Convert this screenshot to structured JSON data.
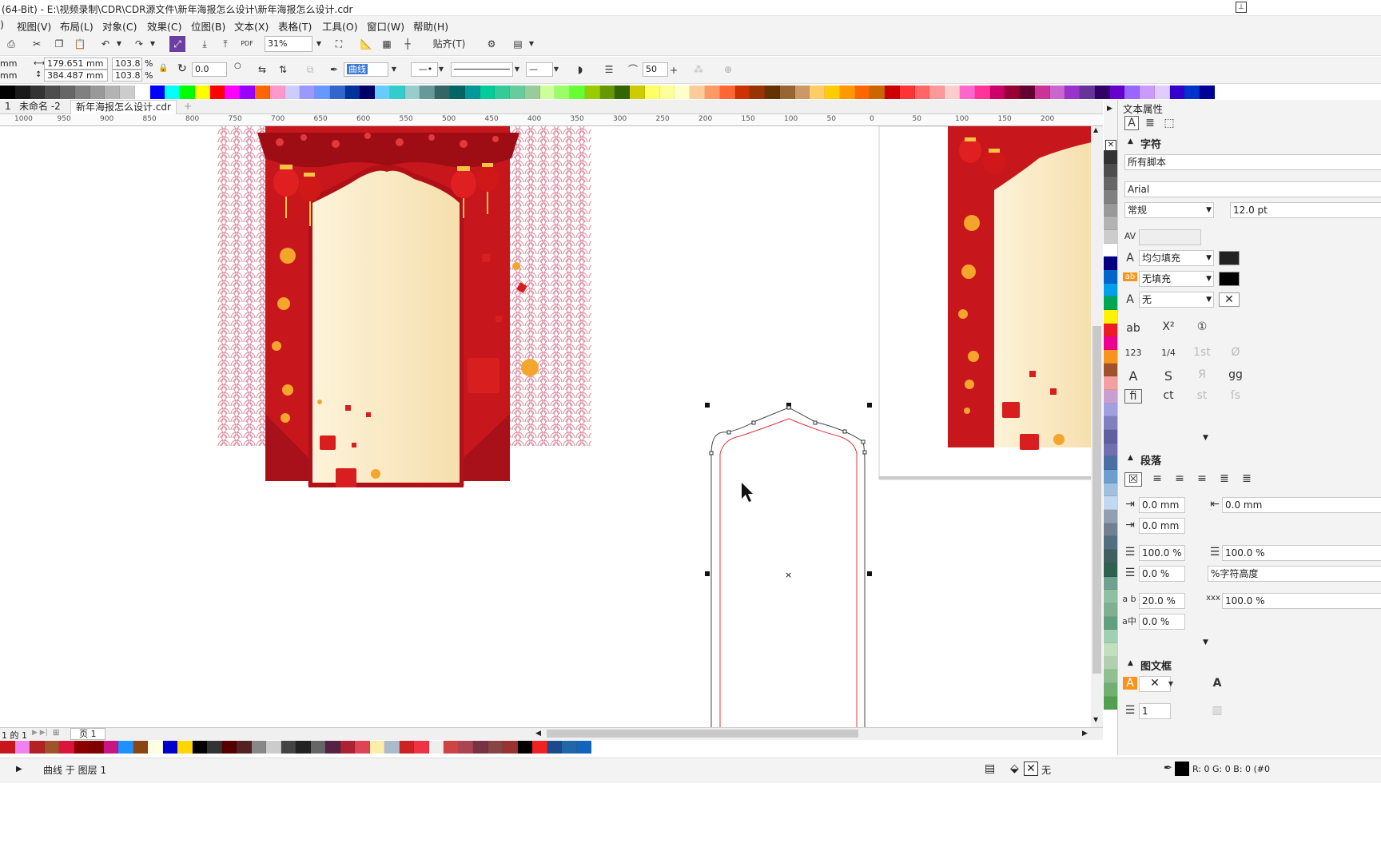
{
  "title": "(64-Bit) - E:\\视频录制\\CDR\\CDR源文件\\新年海报怎么设计\\新年海报怎么设计.cdr",
  "menu": [
    {
      "label": "视图(V)"
    },
    {
      "label": "布局(L)"
    },
    {
      "label": "对象(C)"
    },
    {
      "label": "效果(C)"
    },
    {
      "label": "位图(B)"
    },
    {
      "label": "文本(X)"
    },
    {
      "label": "表格(T)"
    },
    {
      "label": "工具(O)"
    },
    {
      "label": "窗口(W)"
    },
    {
      "label": "帮助(H)"
    }
  ],
  "toolbar": {
    "zoom": "31%",
    "snap": "贴齐(T)",
    "pdf": "PDF"
  },
  "propbar": {
    "unit1": "mm",
    "unit2": "mm",
    "width": "179.651 mm",
    "height": "384.487 mm",
    "scale_x": "103.8",
    "scale_y": "103.8",
    "pct": "%",
    "angle": "0.0",
    "curve_label": "曲线",
    "smooth": "50"
  },
  "doctabs": [
    {
      "label": "1"
    },
    {
      "label": "未命名 -2"
    },
    {
      "label": "新年海报怎么设计.cdr"
    }
  ],
  "ruler": [
    "1000",
    "950",
    "900",
    "850",
    "800",
    "750",
    "700",
    "650",
    "600",
    "550",
    "500",
    "450",
    "400",
    "350",
    "300",
    "250",
    "200",
    "150",
    "100",
    "50",
    "0",
    "50",
    "100",
    "150",
    "200"
  ],
  "panel": {
    "title": "文本属性",
    "char_section": "字符",
    "script": "所有脚本",
    "font": "Arial",
    "style": "常规",
    "size": "12.0 pt",
    "fill1": "均匀填充",
    "fill2": "无填充",
    "outline": "无",
    "para_section": "段落",
    "indent_left": "0.0 mm",
    "indent_right": "0.0 mm",
    "indent_first": "0.0 mm",
    "line_spacing": "100.0 %",
    "char_height": "100.0 %",
    "before_para": "0.0 %",
    "char_height_label": "%字符高度",
    "char_spacing": "20.0 %",
    "word_spacing": "100.0 %",
    "lang_spacing": "0.0 %",
    "frame_section": "图文框",
    "columns": "1"
  },
  "pagebar": {
    "page_of": "1 的 1",
    "page_tab": "页 1"
  },
  "status": {
    "object": "曲线 于 图层 1",
    "fill_none": "无",
    "color": "R: 0 G: 0 B: 0 (#0"
  },
  "colors": {
    "poster_red": "#c8161d",
    "poster_cream": "#f7e3b5",
    "accent": "#e8333a"
  },
  "palette_top": [
    "#000000",
    "#1a1a1a",
    "#333333",
    "#4d4d4d",
    "#666666",
    "#808080",
    "#999999",
    "#b3b3b3",
    "#cccccc",
    "#ffffff",
    "#0000ff",
    "#00ffff",
    "#00ff00",
    "#ffff00",
    "#ff0000",
    "#ff00ff",
    "#9900ff",
    "#ff6600",
    "#ff99cc",
    "#ccccff",
    "#9999ff",
    "#6699ff",
    "#3366cc",
    "#003399",
    "#000066",
    "#66ccff",
    "#33cccc",
    "#99cccc",
    "#669999",
    "#336666",
    "#006666",
    "#009999",
    "#00cc99",
    "#33cc99",
    "#66cc99",
    "#99cc99",
    "#ccff99",
    "#99ff66",
    "#66ff33",
    "#99cc00",
    "#669900",
    "#336600",
    "#cccc00",
    "#ffff66",
    "#ffff99",
    "#ffffcc",
    "#ffcc99",
    "#ff9966",
    "#ff6633",
    "#cc3300",
    "#993300",
    "#663300",
    "#996633",
    "#cc9966",
    "#ffcc66",
    "#ffcc00",
    "#ff9900",
    "#ff6600",
    "#cc6600",
    "#cc0000",
    "#ff3333",
    "#ff6666",
    "#ff9999",
    "#ffcccc",
    "#ff66cc",
    "#ff3399",
    "#cc0066",
    "#990033",
    "#660033",
    "#cc3399",
    "#cc66cc",
    "#9933cc",
    "#663399",
    "#330066",
    "#6600cc",
    "#9966ff",
    "#cc99ff",
    "#e0ccff",
    "#3300cc",
    "#0033cc",
    "#000099"
  ],
  "palette_side": [
    "#333333",
    "#4d4d4d",
    "#666666",
    "#808080",
    "#999999",
    "#b3b3b3",
    "#cccccc",
    "#ffffff",
    "#000080",
    "#0066cc",
    "#00a0e9",
    "#00a651",
    "#fff200",
    "#ed1c24",
    "#ec008c",
    "#f7941d",
    "#a0522d",
    "#f4a0a0",
    "#c8a0d0",
    "#a0a0e0",
    "#8080c0",
    "#6060a0",
    "#7070b0",
    "#4a6fa5",
    "#6a9fd0",
    "#a0c0e0",
    "#c0d8f0",
    "#90a0b0",
    "#708090",
    "#507080",
    "#406060",
    "#306050",
    "#70a090",
    "#90c0a0",
    "#80b090",
    "#60a080",
    "#a0d0b0",
    "#c0e0c0",
    "#b0d0b0",
    "#90c090",
    "#70b070",
    "#50a050"
  ],
  "palette_bottom": [
    "#c8161d",
    "#ee82ee",
    "#b22222",
    "#a0522d",
    "#dc143c",
    "#8b0000",
    "#800000",
    "#c71585",
    "#1e90ff",
    "#8b4513",
    "#ffffe0",
    "#0000cd",
    "#ffd700",
    "#000000",
    "#333333",
    "#550000",
    "#552222",
    "#888888",
    "#cccccc",
    "#444444",
    "#222222",
    "#666666",
    "#552244",
    "#aa2233",
    "#dd4455",
    "#ffeeaa",
    "#aabbcc",
    "#cc2222",
    "#ee3344",
    "#eeeeee",
    "#cc4444",
    "#aa4455",
    "#773344",
    "#884444",
    "#993333",
    "#000000",
    "#ee2222",
    "#1a4a8a",
    "#2266aa",
    "#1166bb"
  ]
}
